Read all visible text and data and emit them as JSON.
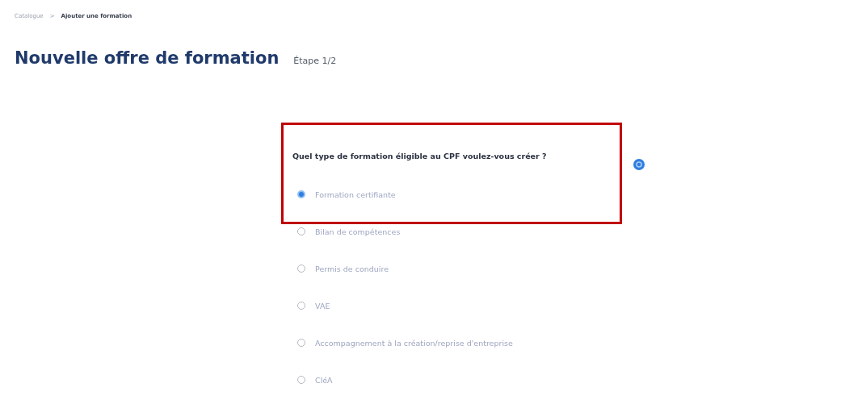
{
  "breadcrumb": [
    {
      "label": "Catalogue",
      "current": false
    },
    {
      "label": "Ajouter une formation",
      "current": true
    }
  ],
  "breadcrumb_separator": ">",
  "title": "Nouvelle offre de formation",
  "step": "Étape 1/2",
  "question": {
    "text": "Quel type de formation éligible au CPF voulez-vous créer ?",
    "highlighted": true
  },
  "options": [
    {
      "label": "Formation certifiante",
      "selected": true
    },
    {
      "label": "Bilan de compétences",
      "selected": false
    },
    {
      "label": "Permis de conduire",
      "selected": false
    },
    {
      "label": "VAE",
      "selected": false
    },
    {
      "label": "Accompagnement à la création/reprise d'entreprise",
      "selected": false
    },
    {
      "label": "CléA",
      "selected": false
    }
  ]
}
